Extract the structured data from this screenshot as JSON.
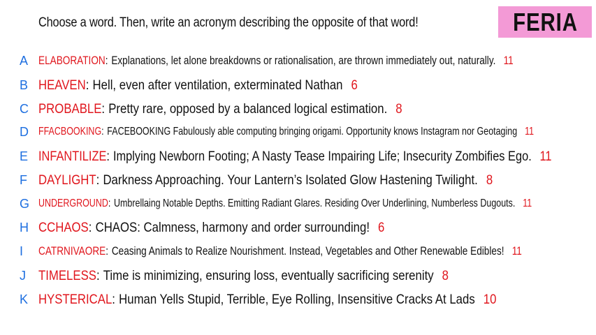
{
  "header": {
    "instruction": "Choose a word. Then, write an acronym describing the opposite of that word!",
    "badge": "FERIA"
  },
  "colors": {
    "letter": "#1e6fe0",
    "word": "#e0161d",
    "badge_bg": "#f39ad6"
  },
  "items": [
    {
      "letter": "A",
      "word": "ELABORATION",
      "text": "Explanations, let alone breakdowns or rationalisation, are thrown immediately out, naturally.",
      "count": "11"
    },
    {
      "letter": "B",
      "word": "HEAVEN",
      "text": "Hell, even after ventilation, exterminated Nathan",
      "count": "6"
    },
    {
      "letter": "C",
      "word": "PROBABLE",
      "text": "Pretty rare, opposed by a balanced logical estimation.",
      "count": "8"
    },
    {
      "letter": "D",
      "word": "FFACBOOKING",
      "text": "FACEBOOKING Fabulously able computing bringing origami. Opportunity knows Instagram nor Geotaging",
      "count": "11"
    },
    {
      "letter": "E",
      "word": "INFANTILIZE",
      "text": "Implying Newborn Footing; A Nasty Tease Impairing Life; Insecurity Zombifies Ego.",
      "count": "11"
    },
    {
      "letter": "F",
      "word": "DAYLIGHT",
      "text": "Darkness Approaching. Your Lantern’s Isolated Glow Hastening Twilight.",
      "count": "8"
    },
    {
      "letter": "G",
      "word": "UNDERGROUND",
      "text": "Umbrellaing Notable Depths. Emitting  Radiant Glares. Residing Over Underlining, Numberless Dugouts.",
      "count": "11"
    },
    {
      "letter": "H",
      "word": "CCHAOS",
      "text": "CHAOS: Calmness, harmony and order surrounding!",
      "count": "6"
    },
    {
      "letter": "I",
      "word": "CATRNIVAORE",
      "text": "Ceasing Animals to Realize Nourishment. Instead, Vegetables and Other Renewable Edibles!",
      "count": "11"
    },
    {
      "letter": "J",
      "word": "TIMELESS",
      "text": "Time is minimizing, ensuring loss,  eventually sacrificing serenity",
      "count": "8"
    },
    {
      "letter": "K",
      "word": "HYSTERICAL",
      "text": "Human Yells Stupid, Terrible, Eye Rolling, Insensitive Cracks At Lads",
      "count": "10"
    }
  ]
}
